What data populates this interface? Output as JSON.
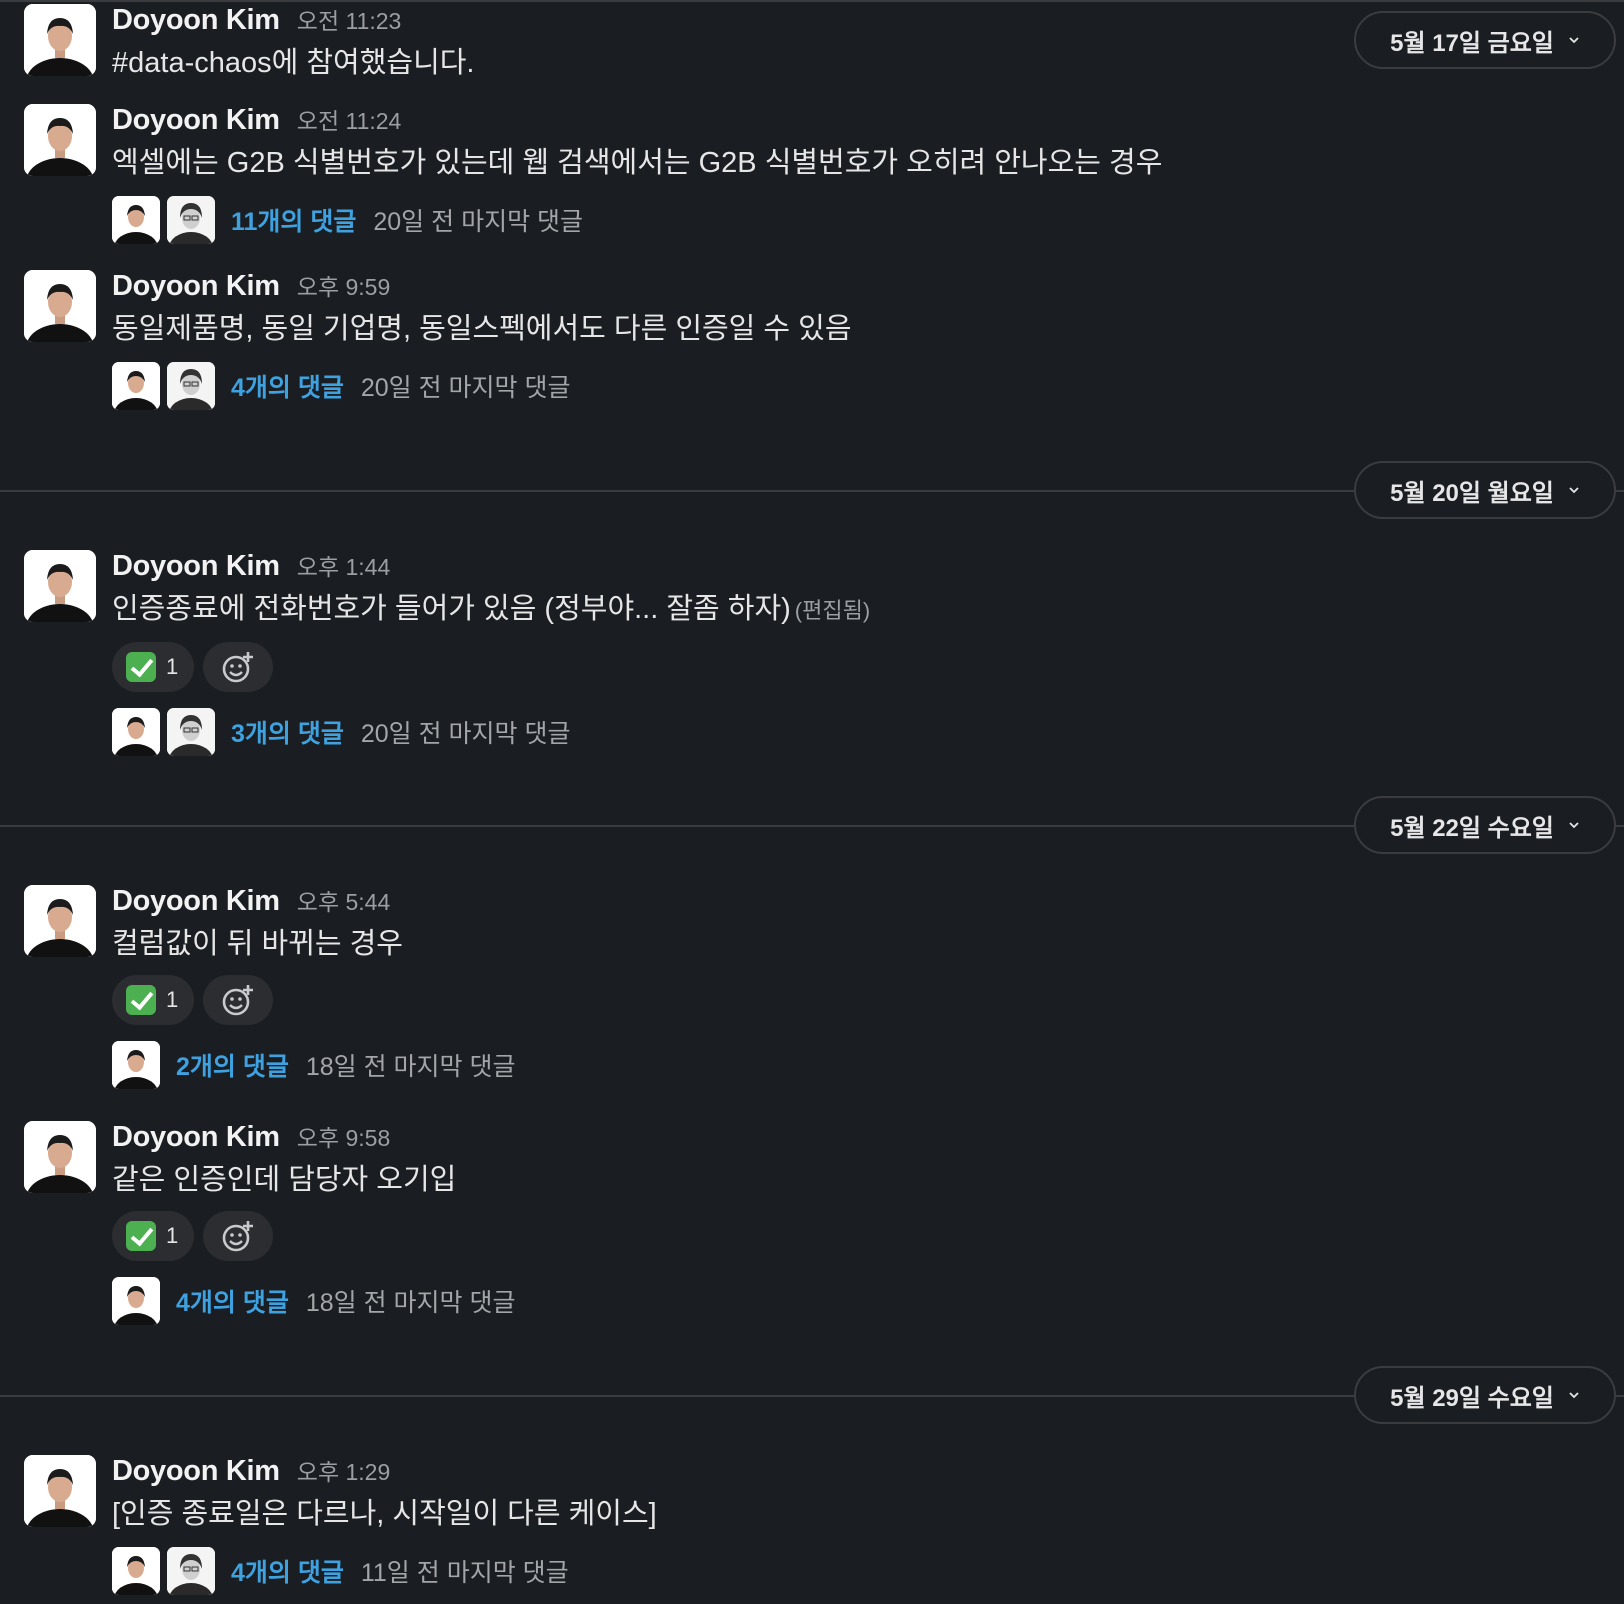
{
  "date_dividers": [
    {
      "label": "5월 17일 금요일"
    },
    {
      "label": "5월 20일 월요일"
    },
    {
      "label": "5월 22일 수요일"
    },
    {
      "label": "5월 29일 수요일"
    }
  ],
  "messages": [
    {
      "author": "Doyoon Kim",
      "time": "오전 11:23",
      "text": "#data-chaos에 참여했습니다."
    },
    {
      "author": "Doyoon Kim",
      "time": "오전 11:24",
      "text": "엑셀에는 G2B 식별번호가 있는데 웹 검색에서는 G2B 식별번호가 오히려 안나오는 경우",
      "thread": {
        "replies": "11개의 댓글",
        "last": "20일 전 마지막 댓글"
      }
    },
    {
      "author": "Doyoon Kim",
      "time": "오후 9:59",
      "text": "동일제품명, 동일 기업명, 동일스펙에서도 다른 인증일 수 있음",
      "thread": {
        "replies": "4개의 댓글",
        "last": "20일 전 마지막 댓글"
      }
    },
    {
      "author": "Doyoon Kim",
      "time": "오후 1:44",
      "text": "인증종료에 전화번호가 들어가 있음 (정부야... 잘좀 하자)",
      "edited": "(편집됨)",
      "reaction": {
        "emoji": "white-check-mark",
        "count": "1"
      },
      "thread": {
        "replies": "3개의 댓글",
        "last": "20일 전 마지막 댓글"
      }
    },
    {
      "author": "Doyoon Kim",
      "time": "오후 5:44",
      "text": "컬럼값이 뒤 바뀌는 경우",
      "reaction": {
        "emoji": "white-check-mark",
        "count": "1"
      },
      "thread": {
        "replies": "2개의 댓글",
        "last": "18일 전 마지막 댓글"
      }
    },
    {
      "author": "Doyoon Kim",
      "time": "오후 9:58",
      "text": "같은 인증인데 담당자 오기입",
      "reaction": {
        "emoji": "white-check-mark",
        "count": "1"
      },
      "thread": {
        "replies": "4개의 댓글",
        "last": "18일 전 마지막 댓글"
      }
    },
    {
      "author": "Doyoon Kim",
      "time": "오후 1:29",
      "text": "[인증 종료일은 다르나, 시작일이 다른 케이스]",
      "thread": {
        "replies": "4개의 댓글",
        "last": "11일 전 마지막 댓글"
      }
    }
  ],
  "colors": {
    "background": "#1a1d21",
    "link": "#3ea1e0",
    "divider": "#3a3c40",
    "reaction_bg": "#2b2d31"
  }
}
